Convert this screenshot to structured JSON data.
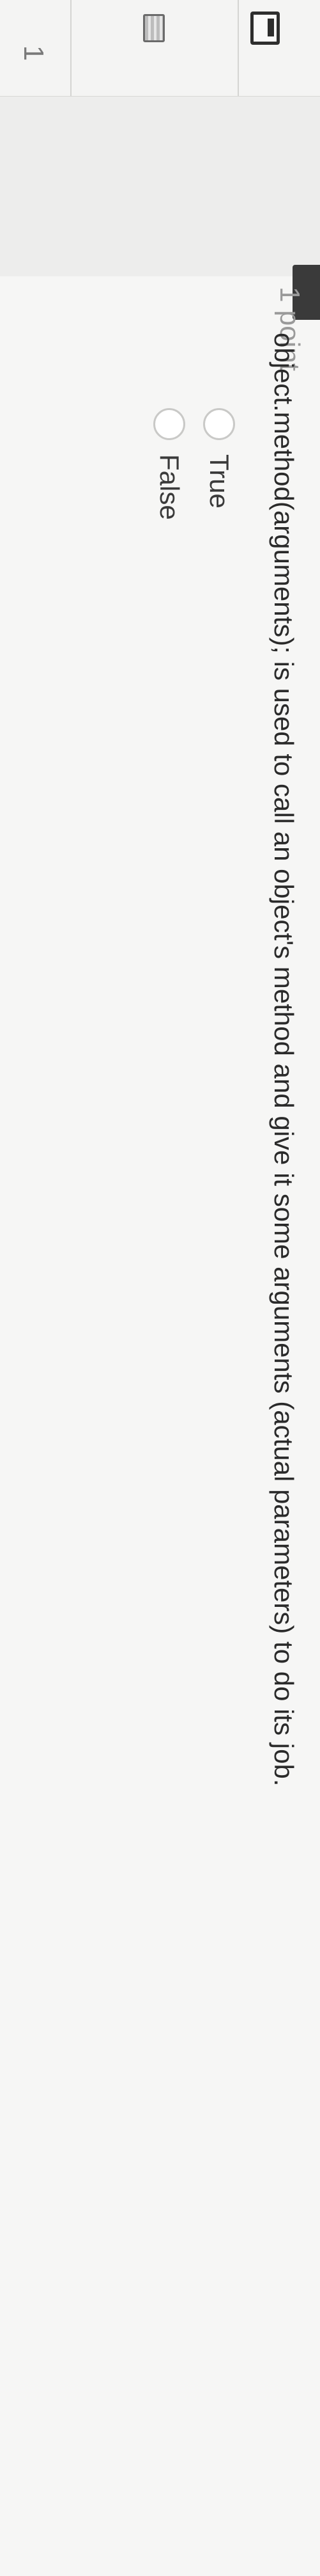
{
  "toolbar": {
    "page_number": "1"
  },
  "question": {
    "points_text": "1 point",
    "text": "object.method(arguments); is used to call an object's method and give it some arguments (actual parameters) to do its job.",
    "options": [
      {
        "label": "True"
      },
      {
        "label": "False"
      }
    ]
  }
}
